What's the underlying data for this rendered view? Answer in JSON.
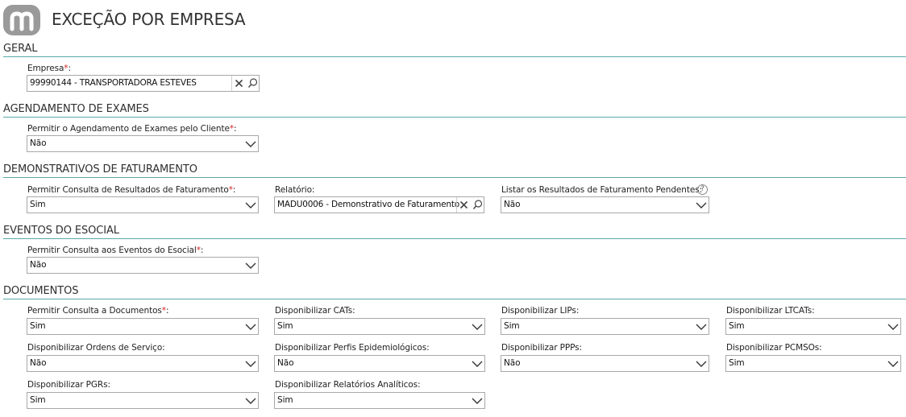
{
  "header": {
    "title": "EXCEÇÃO POR EMPRESA"
  },
  "required_mark": "*",
  "sections": {
    "geral": "GERAL",
    "agendamento": "AGENDAMENTO DE EXAMES",
    "faturamento": "DEMONSTRATIVOS DE FATURAMENTO",
    "esocial": "EVENTOS DO ESOCIAL",
    "documentos": "DOCUMENTOS"
  },
  "fields": {
    "empresa": {
      "label": "Empresa",
      "value": "99990144 - TRANSPORTADORA ESTEVES"
    },
    "agendamento": {
      "label": "Permitir o Agendamento de Exames pelo Cliente",
      "value": "Não"
    },
    "consulta_faturamento": {
      "label": "Permitir Consulta de Resultados de Faturamento",
      "value": "Sim"
    },
    "relatorio": {
      "label": "Relatório:",
      "value": "MADU0006 - Demonstrativo de Faturamento"
    },
    "listar_pendentes": {
      "label": "Listar os Resultados de Faturamento Pendentes:",
      "value": "Não",
      "help": "?"
    },
    "esocial": {
      "label": "Permitir Consulta aos Eventos do Esocial",
      "value": "Não"
    },
    "consulta_documentos": {
      "label": "Permitir Consulta a Documentos",
      "value": "Sim"
    },
    "cats": {
      "label": "Disponibilizar CATs:",
      "value": "Sim"
    },
    "lips": {
      "label": "Disponibilizar LIPs:",
      "value": "Sim"
    },
    "ltcats": {
      "label": "Disponibilizar LTCATs:",
      "value": "Sim"
    },
    "ordens_servico": {
      "label": "Disponibilizar Ordens de Serviço:",
      "value": "Não"
    },
    "perfis": {
      "label": "Disponibilizar Perfis Epidemiológicos:",
      "value": "Não"
    },
    "ppps": {
      "label": "Disponibilizar PPPs:",
      "value": "Não"
    },
    "pcmsos": {
      "label": "Disponibilizar PCMSOs:",
      "value": "Sim"
    },
    "pgrs": {
      "label": "Disponibilizar PGRs:",
      "value": "Sim"
    },
    "relatorios_analiticos": {
      "label": "Disponibilizar Relatórios Analíticos:",
      "value": "Sim"
    }
  },
  "colors": {
    "accent_line": "#5aa8a8",
    "required": "#d32020",
    "logo": "#9a9a9a"
  }
}
